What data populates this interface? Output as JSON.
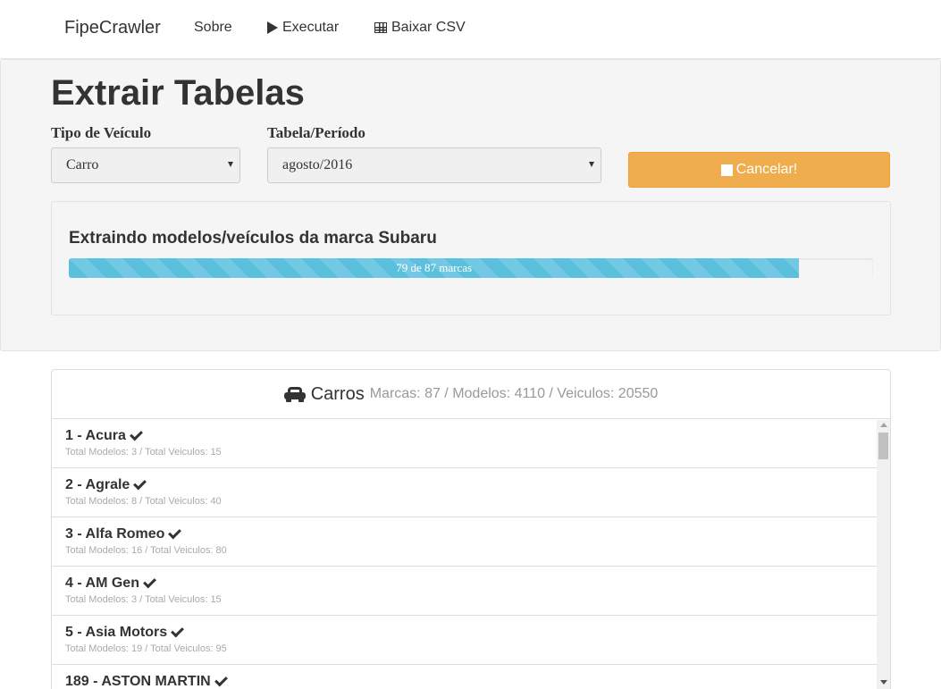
{
  "navbar": {
    "brand": "FipeCrawler",
    "sobre": "Sobre",
    "executar": "Executar",
    "baixar_csv": "Baixar CSV"
  },
  "main": {
    "title": "Extrair Tabelas",
    "tipo_label": "Tipo de Veículo",
    "tipo_value": "Carro",
    "tabela_label": "Tabela/Período",
    "tabela_value": "agosto/2016",
    "cancel_label": "Cancelar!"
  },
  "progress": {
    "title": "Extraindo modelos/veículos da marca Subaru",
    "text": "79 de 87 marcas",
    "current": 79,
    "total": 87,
    "color": "#5bc0de"
  },
  "panel": {
    "title": "Carros",
    "stats": "Marcas: 87 / Modelos: 4110 / Veiculos: 20550",
    "items": [
      {
        "name": "1 - Acura",
        "sub": "Total Modelos: 3 / Total Veiculos: 15"
      },
      {
        "name": "2 - Agrale",
        "sub": "Total Modelos: 8 / Total Veiculos: 40"
      },
      {
        "name": "3 - Alfa Romeo",
        "sub": "Total Modelos: 16 / Total Veiculos: 80"
      },
      {
        "name": "4 - AM Gen",
        "sub": "Total Modelos: 3 / Total Veiculos: 15"
      },
      {
        "name": "5 - Asia Motors",
        "sub": "Total Modelos: 19 / Total Veiculos: 95"
      },
      {
        "name": "189 - ASTON MARTIN",
        "sub": ""
      }
    ]
  },
  "colors": {
    "warning": "#f0ad4e",
    "info": "#5bc0de",
    "muted": "#aaaaaa"
  }
}
